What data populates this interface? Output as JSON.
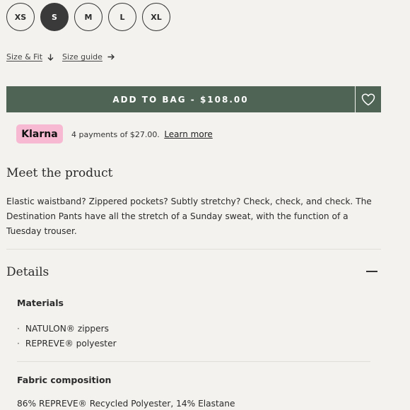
{
  "sizes": [
    {
      "label": "XS",
      "selected": false
    },
    {
      "label": "S",
      "selected": true
    },
    {
      "label": "M",
      "selected": false
    },
    {
      "label": "L",
      "selected": false
    },
    {
      "label": "XL",
      "selected": false
    }
  ],
  "links": {
    "size_fit": "Size & Fit",
    "size_guide": "Size guide"
  },
  "add_to_bag": {
    "label": "ADD TO BAG - $108.00",
    "wishlist_icon": "heart-icon"
  },
  "klarna": {
    "brand": "Klarna",
    "text": "4 payments of $27.00.",
    "link": "Learn more"
  },
  "product": {
    "title": "Meet the product",
    "body": "Elastic waistband? Zippered pockets? Subtly stretchy? Check, check, and check. The Destination Pants have all the stretch of a Sunday sweat, with the function of a Tuesday trouser."
  },
  "details": {
    "title": "Details",
    "materials_title": "Materials",
    "materials": [
      "NATULON® zippers",
      "REPREVE® polyester"
    ],
    "fabric_title": "Fabric composition",
    "fabric": "86% REPREVE® Recycled Polyester, 14% Elastane"
  },
  "colors": {
    "button_green": "#4f6455",
    "klarna_pink": "#f7b8d1",
    "background": "#f3f2ee"
  }
}
